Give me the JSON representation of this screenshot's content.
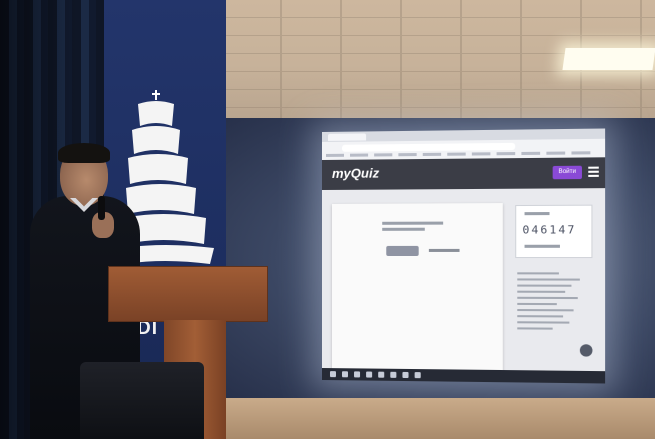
{
  "banner": {
    "text": "DI"
  },
  "projection": {
    "brand": "myQuiz",
    "header_button": "Войти",
    "pin": "046147"
  },
  "colors": {
    "banner_blue": "#1d2e60",
    "wall": "#3c4864",
    "lectern": "#a05c35",
    "app_header": "#3b3d46",
    "accent_purple": "#8a4ad6"
  },
  "icons": [
    "ship-emblem-icon",
    "menu-icon",
    "help-icon"
  ]
}
